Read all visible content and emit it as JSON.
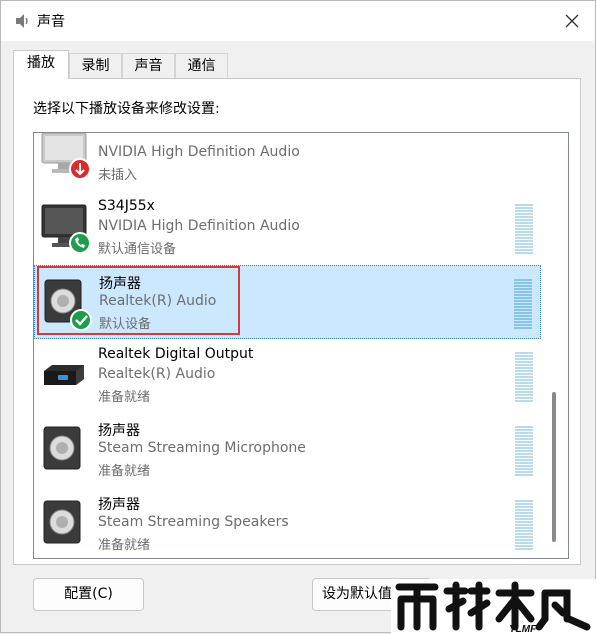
{
  "window": {
    "title": "声音"
  },
  "tabs": [
    {
      "label": "播放",
      "active": true
    },
    {
      "label": "录制",
      "active": false
    },
    {
      "label": "声音",
      "active": false
    },
    {
      "label": "通信",
      "active": false
    }
  ],
  "instruction": "选择以下播放设备来修改设置:",
  "devices": [
    {
      "name": "",
      "driver": "NVIDIA High Definition Audio",
      "status": "未插入",
      "icon": "monitor-disconnected-icon",
      "badge": "unplugged-badge-icon"
    },
    {
      "name": "S34J55x",
      "driver": "NVIDIA High Definition Audio",
      "status": "默认通信设备",
      "icon": "monitor-icon",
      "badge": "phone-badge-icon"
    },
    {
      "name": "扬声器",
      "driver": "Realtek(R) Audio",
      "status": "默认设备",
      "icon": "speaker-icon",
      "badge": "default-check-badge-icon",
      "selected": true
    },
    {
      "name": "Realtek Digital Output",
      "driver": "Realtek(R) Audio",
      "status": "准备就绪",
      "icon": "digital-output-icon"
    },
    {
      "name": "扬声器",
      "driver": "Steam Streaming Microphone",
      "status": "准备就绪",
      "icon": "speaker-icon"
    },
    {
      "name": "扬声器",
      "driver": "Steam Streaming Speakers",
      "status": "准备就绪",
      "icon": "speaker-icon"
    }
  ],
  "buttons": {
    "configure": "配置(C)",
    "set_default": "设为默认值"
  },
  "watermark": {
    "main": "雨林木风",
    "sub": "YLMF"
  },
  "colors": {
    "selection": "#cce8ff",
    "highlight_border": "#d33b3b",
    "check_green": "#1e9e4a",
    "unplugged_red": "#d92c2c"
  }
}
